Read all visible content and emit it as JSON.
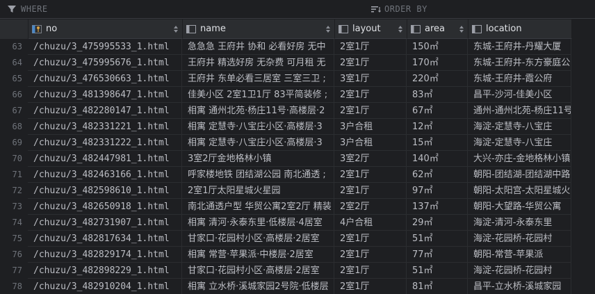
{
  "filter": {
    "where_label": "WHERE",
    "order_label": "ORDER BY"
  },
  "columns": [
    {
      "label": "no",
      "icon": "key-column-icon"
    },
    {
      "label": "name",
      "icon": "column-icon"
    },
    {
      "label": "layout",
      "icon": "column-icon"
    },
    {
      "label": "area",
      "icon": "column-icon"
    },
    {
      "label": "location",
      "icon": "column-icon"
    }
  ],
  "rows": [
    {
      "n": "63",
      "no": "/chuzu/3_475995533_1.html",
      "name": "急急急 王府井 协和 必看好房 无中",
      "layout": "2室1厅",
      "area": "150㎡",
      "location": "东城-王府井-丹耀大厦"
    },
    {
      "n": "64",
      "no": "/chuzu/3_475995676_1.html",
      "name": "王府井 精选好房 无杂费 可月租 无",
      "layout": "2室1厅",
      "area": "170㎡",
      "location": "东城-王府井-东方豪庭公"
    },
    {
      "n": "65",
      "no": "/chuzu/3_476530663_1.html",
      "name": "王府井 东单必看三居室 三室三卫 ;",
      "layout": "3室1厅",
      "area": "220㎡",
      "location": "东城-王府井-霞公府"
    },
    {
      "n": "66",
      "no": "/chuzu/3_481398647_1.html",
      "name": "佳美小区 2室1卫1厅 83平简装修 ;",
      "layout": "2室1厅",
      "area": "83㎡",
      "location": "昌平-沙河-佳美小区"
    },
    {
      "n": "67",
      "no": "/chuzu/3_482280147_1.html",
      "name": "相寓 通州北苑·杨庄11号·高楼层·2",
      "layout": "2室1厅",
      "area": "67㎡",
      "location": "通州-通州北苑-杨庄11号"
    },
    {
      "n": "68",
      "no": "/chuzu/3_482331221_1.html",
      "name": "相寓 定慧寺·八宝庄小区·高楼层·3",
      "layout": "3户合租",
      "area": "12㎡",
      "location": "海淀-定慧寺-八宝庄"
    },
    {
      "n": "69",
      "no": "/chuzu/3_482331222_1.html",
      "name": "相寓 定慧寺·八宝庄小区·高楼层·3",
      "layout": "3户合租",
      "area": "15㎡",
      "location": "海淀-定慧寺-八宝庄"
    },
    {
      "n": "70",
      "no": "/chuzu/3_482447981_1.html",
      "name": "3室2厅金地格林小镇",
      "layout": "3室2厅",
      "area": "140㎡",
      "location": "大兴-亦庄-金地格林小镇"
    },
    {
      "n": "71",
      "no": "/chuzu/3_482463166_1.html",
      "name": "呼家楼地铁 团结湖公园 南北通透 ;",
      "layout": "2室1厅",
      "area": "62㎡",
      "location": "朝阳-团结湖-团结湖中路"
    },
    {
      "n": "72",
      "no": "/chuzu/3_482598610_1.html",
      "name": "2室1厅太阳星城火星园",
      "layout": "2室1厅",
      "area": "97㎡",
      "location": "朝阳-太阳宫-太阳星城火"
    },
    {
      "n": "73",
      "no": "/chuzu/3_482650918_1.html",
      "name": "南北通透户型 华贸公寓2室2厅 精装",
      "layout": "2室2厅",
      "area": "137㎡",
      "location": "朝阳-大望路-华贸公寓"
    },
    {
      "n": "74",
      "no": "/chuzu/3_482731907_1.html",
      "name": "相寓 清河·永泰东里·低楼层·4居室",
      "layout": "4户合租",
      "area": "29㎡",
      "location": "海淀-清河-永泰东里"
    },
    {
      "n": "75",
      "no": "/chuzu/3_482817634_1.html",
      "name": "甘家口·花园村小区·高楼层·2居室",
      "layout": "2室1厅",
      "area": "51㎡",
      "location": "海淀-花园桥-花园村"
    },
    {
      "n": "76",
      "no": "/chuzu/3_482829174_1.html",
      "name": "相寓 常营·苹果派·中楼层·2居室",
      "layout": "2室1厅",
      "area": "77㎡",
      "location": "朝阳-常营-苹果派"
    },
    {
      "n": "77",
      "no": "/chuzu/3_482898229_1.html",
      "name": "甘家口·花园村小区·高楼层·2居室",
      "layout": "2室1厅",
      "area": "51㎡",
      "location": "海淀-花园桥-花园村"
    },
    {
      "n": "78",
      "no": "/chuzu/3_482910204_1.html",
      "name": "相寓 立水桥·溪城家园2号院·低楼层",
      "layout": "2室1厅",
      "area": "81㎡",
      "location": "昌平-立水桥-溪城家园"
    }
  ]
}
